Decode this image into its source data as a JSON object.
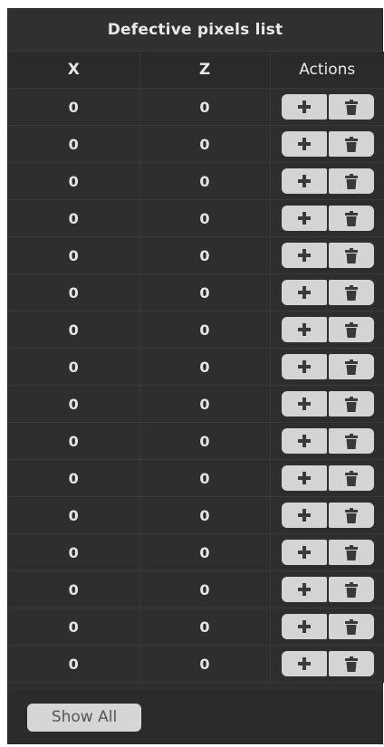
{
  "panel": {
    "title": "Defective pixels list"
  },
  "table": {
    "columns": [
      "X",
      "Z",
      "Actions"
    ],
    "rows": [
      {
        "x": "0",
        "z": "0"
      },
      {
        "x": "0",
        "z": "0"
      },
      {
        "x": "0",
        "z": "0"
      },
      {
        "x": "0",
        "z": "0"
      },
      {
        "x": "0",
        "z": "0"
      },
      {
        "x": "0",
        "z": "0"
      },
      {
        "x": "0",
        "z": "0"
      },
      {
        "x": "0",
        "z": "0"
      },
      {
        "x": "0",
        "z": "0"
      },
      {
        "x": "0",
        "z": "0"
      },
      {
        "x": "0",
        "z": "0"
      },
      {
        "x": "0",
        "z": "0"
      },
      {
        "x": "0",
        "z": "0"
      },
      {
        "x": "0",
        "z": "0"
      },
      {
        "x": "0",
        "z": "0"
      },
      {
        "x": "0",
        "z": "0"
      }
    ],
    "row_actions": [
      "plus-icon",
      "trash-icon"
    ]
  },
  "footer": {
    "show_all_label": "Show All"
  },
  "colors": {
    "panel_bg": "#2f2f2f",
    "button_bg": "#d4d4d4",
    "icon": "#3a3a3a",
    "text": "#e6e6e6"
  }
}
